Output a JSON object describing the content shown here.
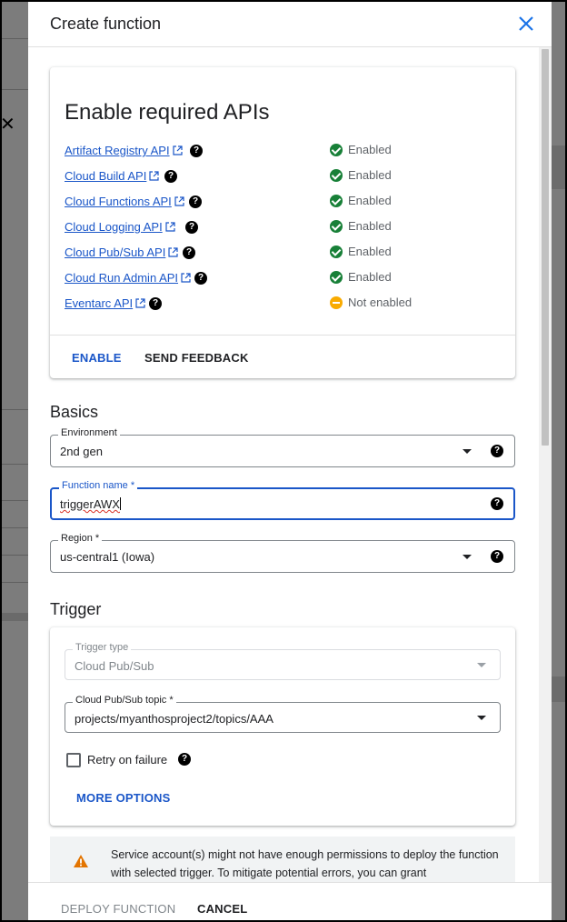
{
  "dialog": {
    "title": "Create function"
  },
  "apis_card": {
    "heading": "Enable required APIs",
    "apis": [
      {
        "name": "Artifact Registry API",
        "status": "Enabled",
        "enabled": true
      },
      {
        "name": "Cloud Build API",
        "status": "Enabled",
        "enabled": true
      },
      {
        "name": "Cloud Functions API",
        "status": "Enabled",
        "enabled": true
      },
      {
        "name": "Cloud Logging API",
        "status": "Enabled",
        "enabled": true
      },
      {
        "name": "Cloud Pub/Sub API",
        "status": "Enabled",
        "enabled": true
      },
      {
        "name": "Cloud Run Admin API",
        "status": "Enabled",
        "enabled": true
      },
      {
        "name": "Eventarc API",
        "status": "Not enabled",
        "enabled": false
      }
    ],
    "enable_label": "ENABLE",
    "feedback_label": "SEND FEEDBACK"
  },
  "basics": {
    "title": "Basics",
    "environment": {
      "label": "Environment",
      "value": "2nd gen"
    },
    "function_name": {
      "label": "Function name *",
      "value": "triggerAWX"
    },
    "region": {
      "label": "Region *",
      "value": "us-central1 (Iowa)"
    }
  },
  "trigger": {
    "title": "Trigger",
    "trigger_type": {
      "label": "Trigger type",
      "value": "Cloud Pub/Sub"
    },
    "topic": {
      "label": "Cloud Pub/Sub topic *",
      "value": "projects/myanthosproject2/topics/AAA"
    },
    "retry_label": "Retry on failure",
    "retry_checked": false,
    "more_options_label": "MORE OPTIONS"
  },
  "warning": {
    "text": "Service account(s) might not have enough permissions to deploy the function with selected trigger. To mitigate potential errors, you can grant"
  },
  "footer": {
    "deploy_label": "DEPLOY FUNCTION",
    "cancel_label": "CANCEL"
  },
  "colors": {
    "accent": "#1a73e8",
    "link": "#1a56c8",
    "enabled": "#188038",
    "not_enabled": "#f9ab00",
    "warning_icon": "#e37400"
  },
  "icons": {
    "close": "close-icon",
    "external": "open-in-new-icon",
    "help": "help-icon",
    "enabled": "check-circle-icon",
    "not_enabled": "minus-circle-icon",
    "warning": "warning-icon",
    "dropdown": "arrow-drop-down-icon"
  }
}
